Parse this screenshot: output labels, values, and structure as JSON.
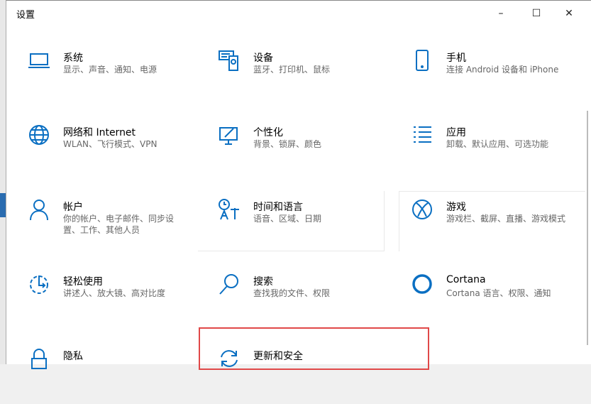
{
  "window": {
    "title": "设置",
    "minimize": "–",
    "maximize": "☐",
    "close": "✕"
  },
  "items": [
    {
      "title": "系统",
      "subtitle": "显示、声音、通知、电源",
      "icon": "laptop-icon"
    },
    {
      "title": "设备",
      "subtitle": "蓝牙、打印机、鼠标",
      "icon": "devices-icon"
    },
    {
      "title": "手机",
      "subtitle": "连接 Android 设备和 iPhone",
      "icon": "phone-icon"
    },
    {
      "title": "网络和 Internet",
      "subtitle": "WLAN、飞行模式、VPN",
      "icon": "globe-icon"
    },
    {
      "title": "个性化",
      "subtitle": "背景、锁屏、颜色",
      "icon": "personalize-icon"
    },
    {
      "title": "应用",
      "subtitle": "卸载、默认应用、可选功能",
      "icon": "apps-icon"
    },
    {
      "title": "帐户",
      "subtitle": "你的帐户、电子邮件、同步设置、工作、其他人员",
      "icon": "person-icon"
    },
    {
      "title": "时间和语言",
      "subtitle": "语音、区域、日期",
      "icon": "time-language-icon"
    },
    {
      "title": "游戏",
      "subtitle": "游戏栏、截屏、直播、游戏模式",
      "icon": "xbox-icon"
    },
    {
      "title": "轻松使用",
      "subtitle": "讲述人、放大镜、高对比度",
      "icon": "ease-of-access-icon"
    },
    {
      "title": "搜索",
      "subtitle": "查找我的文件、权限",
      "icon": "search-icon"
    },
    {
      "title": "Cortana",
      "subtitle": "Cortana 语言、权限、通知",
      "icon": "cortana-icon"
    },
    {
      "title": "隐私",
      "subtitle": "",
      "icon": "lock-icon"
    },
    {
      "title": "更新和安全",
      "subtitle": "",
      "icon": "update-icon"
    }
  ],
  "colors": {
    "accent": "#0a6fc2",
    "highlight": "#e04848"
  }
}
